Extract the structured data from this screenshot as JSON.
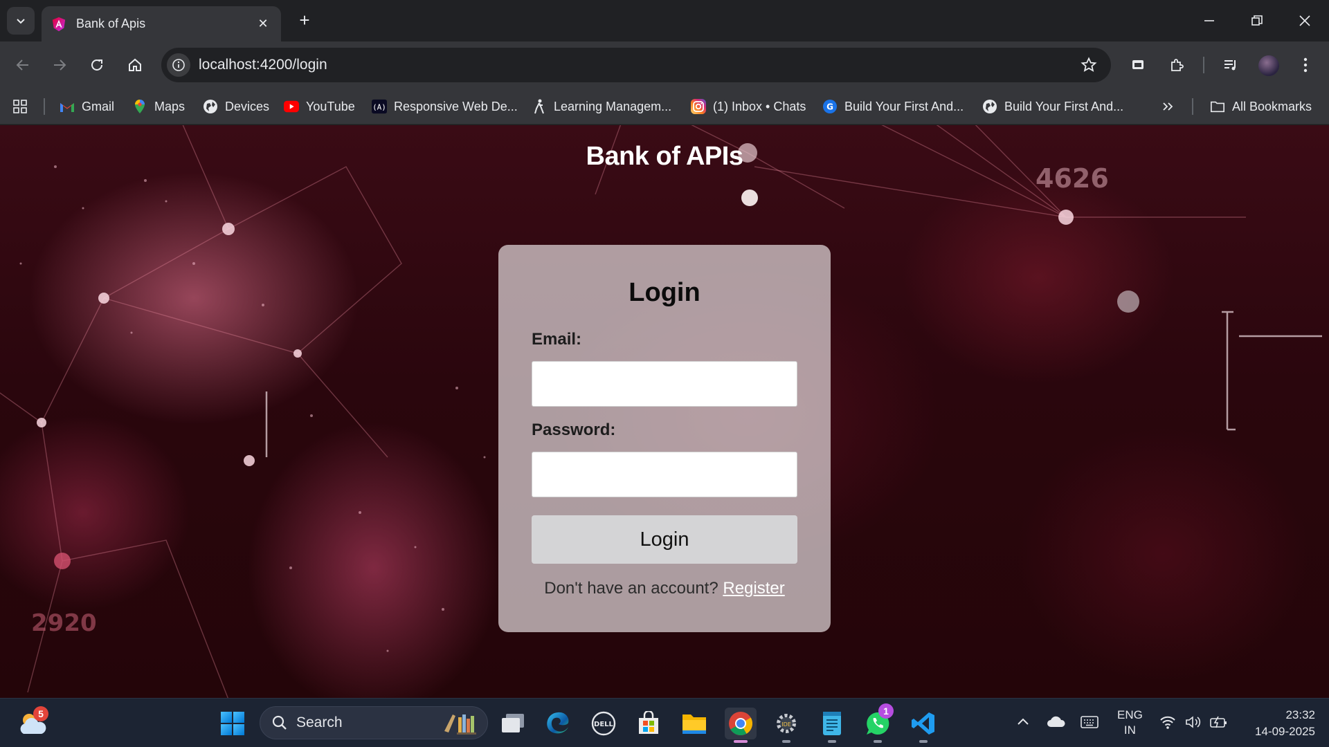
{
  "browser": {
    "tab_title": "Bank of Apis",
    "url": "localhost:4200/login",
    "bookmarks": [
      {
        "label": "Gmail",
        "icon": "gmail-icon"
      },
      {
        "label": "Maps",
        "icon": "maps-icon"
      },
      {
        "label": "Devices",
        "icon": "globe-icon"
      },
      {
        "label": "YouTube",
        "icon": "youtube-icon"
      },
      {
        "label": "Responsive Web De...",
        "icon": "freecodecamp-icon"
      },
      {
        "label": "Learning Managem...",
        "icon": "lms-icon"
      },
      {
        "label": "(1) Inbox • Chats",
        "icon": "instagram-icon"
      },
      {
        "label": "Build Your First And...",
        "icon": "course-icon"
      },
      {
        "label": "Build Your First And...",
        "icon": "globe-icon"
      }
    ],
    "all_bookmarks_label": "All Bookmarks"
  },
  "page": {
    "app_title": "Bank of APIs",
    "background_numbers": [
      "4626",
      "2920"
    ],
    "login": {
      "heading": "Login",
      "email_label": "Email:",
      "email_value": "",
      "password_label": "Password:",
      "password_value": "",
      "submit_label": "Login",
      "register_prompt": "Don't have an account?",
      "register_link": "Register"
    }
  },
  "taskbar": {
    "weather_badge": "5",
    "search_placeholder": "Search",
    "whatsapp_badge": "1",
    "language_line1": "ENG",
    "language_line2": "IN",
    "time": "23:32",
    "date": "14-09-2025"
  },
  "colors": {
    "chrome_dark": "#202124",
    "chrome_toolbar": "#35363a",
    "card_bg": "#e1d7d9",
    "button_bg": "#d4d4d6",
    "taskbar_bg": "#1c2433"
  }
}
